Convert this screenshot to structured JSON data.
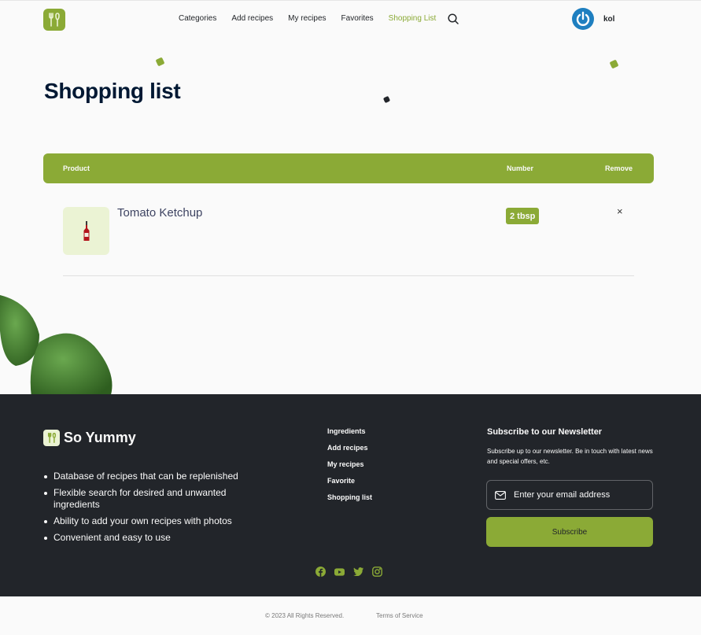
{
  "nav": {
    "items": [
      {
        "label": "Categories",
        "active": false
      },
      {
        "label": "Add recipes",
        "active": false
      },
      {
        "label": "My recipes",
        "active": false
      },
      {
        "label": "Favorites",
        "active": false
      },
      {
        "label": "Shopping List",
        "active": true
      }
    ],
    "search_icon": "search-icon"
  },
  "user": {
    "name": "kol"
  },
  "page": {
    "title": "Shopping list"
  },
  "table": {
    "headers": {
      "product": "Product",
      "number": "Number",
      "remove": "Remove"
    },
    "rows": [
      {
        "product": "Tomato Ketchup",
        "number": "2 tbsp",
        "remove": "×"
      }
    ]
  },
  "footer": {
    "brand": "So Yummy",
    "features": [
      "Database of recipes that can be replenished",
      "Flexible search for desired and unwanted ingredients",
      "Ability to add your own recipes with photos",
      "Convenient and easy to use"
    ],
    "links": [
      "Ingredients",
      "Add recipes",
      "My recipes",
      "Favorite",
      "Shopping list"
    ],
    "newsletter": {
      "title": "Subscribe to our Newsletter",
      "text": "Subscribe up to our newsletter. Be in touch with latest news and special offers, etc.",
      "email_placeholder": "Enter your email address",
      "button": "Subscribe"
    },
    "social_icons": [
      "facebook-icon",
      "youtube-icon",
      "twitter-icon",
      "instagram-icon"
    ]
  },
  "bottom": {
    "copyright": "© 2023 All Rights Reserved.",
    "terms": "Terms of Service"
  },
  "colors": {
    "accent": "#8baa36",
    "dark": "#22252a",
    "background": "#fafafa"
  }
}
